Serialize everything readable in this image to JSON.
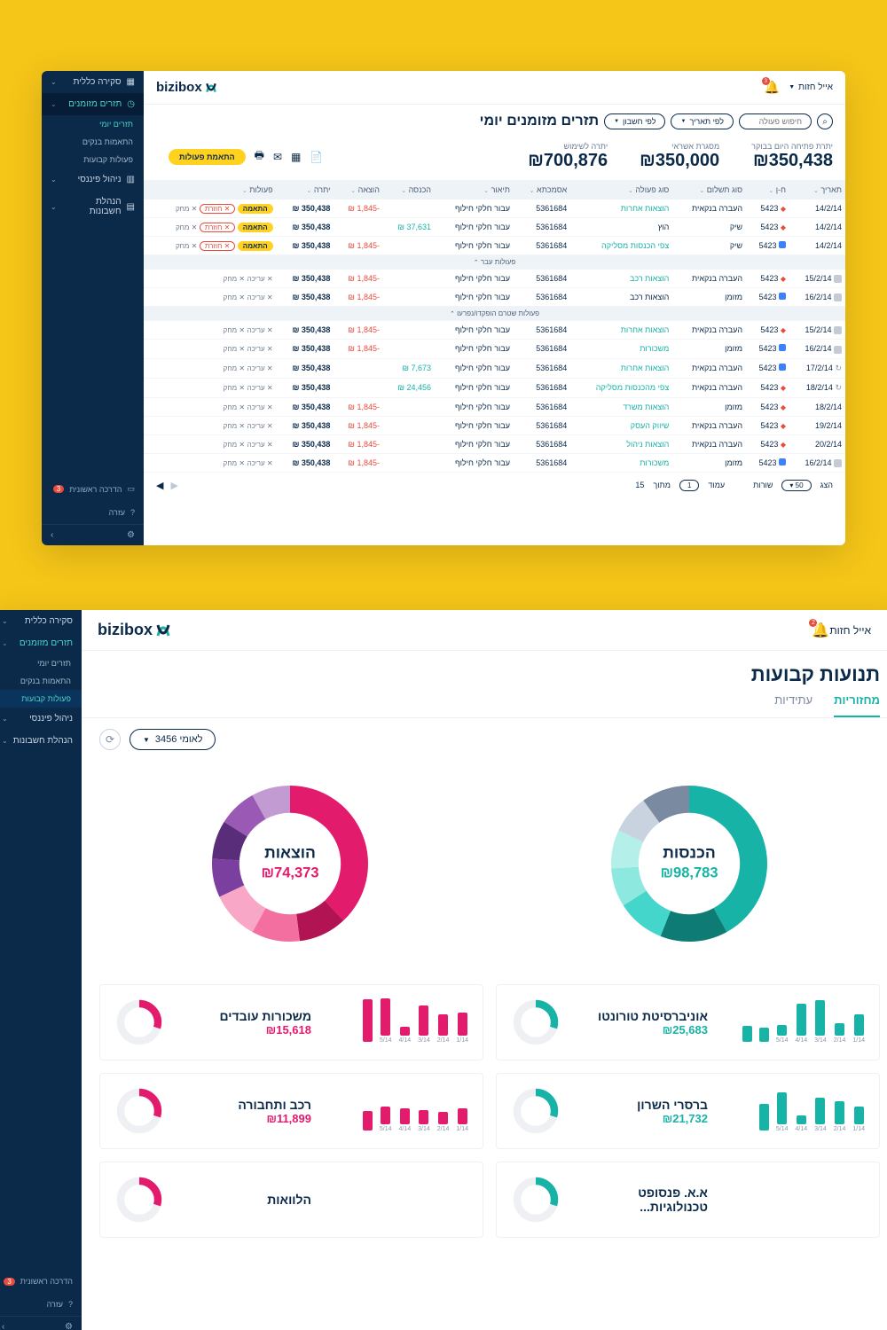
{
  "brand": "bizibox",
  "user_name": "אייל חזות",
  "notif_count": "3",
  "sidebar": {
    "items": [
      {
        "label": "סקירה כללית",
        "icon": "grid"
      },
      {
        "label": "תזרים מזומנים",
        "icon": "clock"
      },
      {
        "label": "ניהול פיננסי",
        "icon": "bars"
      },
      {
        "label": "הנהלת חשבונות",
        "icon": "ledger"
      }
    ],
    "sub_cashflow": [
      "תזרים יומי",
      "התאמות בנקים",
      "פעולות קבועות"
    ],
    "bottom_help_label": "הדרכה ראשונית",
    "bottom_help_badge": "3",
    "bottom_help2": "עזרה"
  },
  "screen1": {
    "title": "תזרים מזומנים יומי",
    "filters": {
      "by_account": "לפי חשבון",
      "by_date": "לפי תאריך",
      "search": "חיפוש פעולה"
    },
    "summary": [
      {
        "label": "יתרת פתיחה היום בבוקר",
        "value": "₪350,438"
      },
      {
        "label": "מסגרת אשראי",
        "value": "₪350,000"
      },
      {
        "label": "יתרה לשימוש",
        "value": "₪700,876"
      }
    ],
    "match_btn": "התאמת פעולות",
    "columns": [
      "תאריך",
      "ח-ן",
      "סוג תשלום",
      "סוג פעולה",
      "אסמכתא",
      "תיאור",
      "הכנסה",
      "הוצאה",
      "יתרה",
      "פעולות"
    ],
    "sep1": "פעולות עבר",
    "sep2": "פעולות שטרם הופקדו/נפרעו",
    "rows": [
      {
        "date": "14/2/14",
        "acc": "5423",
        "accmark": "red",
        "pay": "העברה בנקאית",
        "type": "הוצאות אחרות",
        "typec": "teal",
        "ref": "5361684",
        "desc": "עבור חלקי חילוף",
        "in": "",
        "out": "-1,845",
        "outc": "red",
        "bal": "350,438",
        "act1": "התאמה",
        "act2": "חוזרת",
        "act3": "מחק"
      },
      {
        "date": "14/2/14",
        "acc": "5423",
        "accmark": "red",
        "pay": "שיק",
        "type": "הוץ",
        "typec": "",
        "ref": "5361684",
        "desc": "עבור חלקי חילוף",
        "in": "37,631",
        "inc": "teal",
        "out": "",
        "bal": "350,438",
        "act1": "התאמה",
        "act2": "חוזרת",
        "act3": "מחק"
      },
      {
        "date": "14/2/14",
        "acc": "5423",
        "accmark": "blue",
        "pay": "שיק",
        "type": "צפי הכנסות מסליקה",
        "typec": "teal",
        "ref": "5361684",
        "desc": "עבור חלקי חילוף",
        "in": "",
        "out": "-1,845",
        "outc": "red",
        "bal": "350,438",
        "act1": "התאמה",
        "act2": "חוזרת",
        "act3": "מחק"
      }
    ],
    "rows2": [
      {
        "date": "15/2/14",
        "acc": "5423",
        "accmark": "red",
        "pay": "העברה בנקאית",
        "type": "הוצאות רכב",
        "typec": "teal",
        "ref": "5361684",
        "desc": "עבור חלקי חילוף",
        "in": "",
        "out": "-1,845",
        "outc": "red",
        "bal": "350,438",
        "act1": "",
        "act2": "עריכה",
        "act3": "מחק",
        "icon": "sq"
      },
      {
        "date": "16/2/14",
        "acc": "5423",
        "accmark": "blue",
        "pay": "מזומן",
        "type": "הוצאות רכב",
        "typec": "",
        "ref": "5361684",
        "desc": "עבור חלקי חילוף",
        "in": "",
        "out": "-1,845",
        "outc": "red",
        "bal": "350,438",
        "act1": "",
        "act2": "עריכה",
        "act3": "מחק",
        "icon": "sq"
      }
    ],
    "rows3": [
      {
        "date": "15/2/14",
        "acc": "5423",
        "accmark": "red",
        "pay": "העברה בנקאית",
        "type": "הוצאות אחרות",
        "typec": "teal",
        "ref": "5361684",
        "desc": "עבור חלקי חילוף",
        "in": "",
        "out": "-1,845",
        "outc": "red",
        "bal": "350,438",
        "act1": "",
        "act2": "עריכה",
        "act3": "מחק",
        "icon": "sq"
      },
      {
        "date": "16/2/14",
        "acc": "5423",
        "accmark": "blue",
        "pay": "מזומן",
        "type": "משכורות",
        "typec": "teal",
        "ref": "5361684",
        "desc": "עבור חלקי חילוף",
        "in": "",
        "out": "-1,845",
        "outc": "red",
        "bal": "350,438",
        "act1": "",
        "act2": "עריכה",
        "act3": "מחק",
        "icon": "sq"
      },
      {
        "date": "17/2/14",
        "acc": "5423",
        "accmark": "blue",
        "pay": "העברה בנקאית",
        "type": "הוצאות אחרות",
        "typec": "teal",
        "ref": "5361684",
        "desc": "עבור חלקי חילוף",
        "in": "7,673",
        "inc": "teal",
        "out": "",
        "bal": "350,438",
        "act1": "",
        "act2": "עריכה",
        "act3": "מחק",
        "icon": "cyc"
      },
      {
        "date": "18/2/14",
        "acc": "5423",
        "accmark": "red",
        "pay": "העברה בנקאית",
        "type": "צפי מהכנסות מסליקה",
        "typec": "teal",
        "ref": "5361684",
        "desc": "עבור חלקי חילוף",
        "in": "24,456",
        "inc": "teal",
        "out": "",
        "bal": "350,438",
        "act1": "",
        "act2": "עריכה",
        "act3": "מחק",
        "icon": "cyc"
      },
      {
        "date": "18/2/14",
        "acc": "5423",
        "accmark": "red",
        "pay": "מזומן",
        "type": "הוצאות משרד",
        "typec": "teal",
        "ref": "5361684",
        "desc": "עבור חלקי חילוף",
        "in": "",
        "out": "-1,845",
        "outc": "red",
        "bal": "350,438",
        "act1": "",
        "act2": "עריכה",
        "act3": "מחק"
      },
      {
        "date": "19/2/14",
        "acc": "5423",
        "accmark": "red",
        "pay": "העברה בנקאית",
        "type": "שיווק העסק",
        "typec": "teal",
        "ref": "5361684",
        "desc": "עבור חלקי חילוף",
        "in": "",
        "out": "-1,845",
        "outc": "red",
        "bal": "350,438",
        "act1": "",
        "act2": "עריכה",
        "act3": "מחק"
      },
      {
        "date": "20/2/14",
        "acc": "5423",
        "accmark": "red",
        "pay": "העברה בנקאית",
        "type": "הוצאות ניהול",
        "typec": "teal",
        "ref": "5361684",
        "desc": "עבור חלקי חילוף",
        "in": "",
        "out": "-1,845",
        "outc": "red",
        "bal": "350,438",
        "act1": "",
        "act2": "עריכה",
        "act3": "מחק"
      },
      {
        "date": "16/2/14",
        "acc": "5423",
        "accmark": "blue",
        "pay": "מזומן",
        "type": "משכורות",
        "typec": "teal",
        "ref": "5361684",
        "desc": "עבור חלקי חילוף",
        "in": "",
        "out": "-1,845",
        "outc": "red",
        "bal": "350,438",
        "act1": "",
        "act2": "עריכה",
        "act3": "מחק",
        "icon": "sq"
      }
    ],
    "pager": {
      "show": "הצג",
      "rows": "50",
      "rows_lbl": "שורות",
      "page_lbl": "עמוד",
      "page": "1",
      "of_lbl": "מתוך",
      "total": "15"
    }
  },
  "screen2": {
    "title": "תנועות קבועות",
    "tabs": [
      "מחזוריות",
      "עתידיות"
    ],
    "account_pill": "לאומי 3456",
    "donuts": {
      "income_label": "הכנסות",
      "income_val": "₪98,783",
      "expense_label": "הוצאות",
      "expense_val": "₪74,373"
    },
    "cards": [
      {
        "title": "אוניברסיטת טורונטו",
        "value": "₪25,683",
        "color": "teal",
        "bars": [
          24,
          14,
          40,
          36,
          12,
          16,
          18
        ],
        "labels": [
          "1/14",
          "2/14",
          "3/14",
          "4/14",
          "5/14",
          "",
          ""
        ]
      },
      {
        "title": "משכורות עובדים",
        "value": "₪15,618",
        "color": "pink",
        "bars": [
          26,
          24,
          34,
          10,
          42,
          48
        ],
        "labels": [
          "1/14",
          "2/14",
          "3/14",
          "4/14",
          "5/14",
          ""
        ]
      },
      {
        "title": "ברסרי השרון",
        "value": "₪21,732",
        "color": "teal",
        "bars": [
          20,
          26,
          30,
          10,
          36,
          30
        ],
        "labels": [
          "1/14",
          "2/14",
          "3/14",
          "4/14",
          "5/14",
          ""
        ]
      },
      {
        "title": "רכב ותחבורה",
        "value": "₪11,899",
        "color": "pink",
        "bars": [
          18,
          14,
          16,
          18,
          20,
          22
        ],
        "labels": [
          "1/14",
          "2/14",
          "3/14",
          "4/14",
          "5/14",
          ""
        ]
      },
      {
        "title": "א.א. פנסופט טכנולוגיות...",
        "value": "",
        "color": "teal",
        "bars": [],
        "labels": []
      },
      {
        "title": "הלוואות",
        "value": "",
        "color": "pink",
        "bars": [],
        "labels": []
      }
    ]
  },
  "chart_data": [
    {
      "type": "pie",
      "title": "הכנסות",
      "total": 98783,
      "unit": "₪",
      "slices": [
        {
          "name": "s1",
          "value": 42
        },
        {
          "name": "s2",
          "value": 14
        },
        {
          "name": "s3",
          "value": 10
        },
        {
          "name": "s4",
          "value": 8
        },
        {
          "name": "s5",
          "value": 8
        },
        {
          "name": "s6",
          "value": 8
        },
        {
          "name": "s7",
          "value": 10
        }
      ],
      "palette": [
        "#18b3a7",
        "#0e7c74",
        "#45d6cb",
        "#8de8e0",
        "#b5efe9",
        "#c9d3df",
        "#7a8aa0"
      ]
    },
    {
      "type": "pie",
      "title": "הוצאות",
      "total": 74373,
      "unit": "₪",
      "slices": [
        {
          "name": "s1",
          "value": 38
        },
        {
          "name": "s2",
          "value": 10
        },
        {
          "name": "s3",
          "value": 10
        },
        {
          "name": "s4",
          "value": 10
        },
        {
          "name": "s5",
          "value": 8
        },
        {
          "name": "s6",
          "value": 8
        },
        {
          "name": "s7",
          "value": 8
        },
        {
          "name": "s8",
          "value": 8
        }
      ],
      "palette": [
        "#e31b6d",
        "#b21453",
        "#f36fa0",
        "#f8a8c6",
        "#7b3fa0",
        "#5a2d7a",
        "#9b59b6",
        "#c39bd3"
      ]
    },
    {
      "type": "bar",
      "title": "אוניברסיטת טורונטו",
      "categories": [
        "1/14",
        "2/14",
        "3/14",
        "4/14",
        "5/14"
      ],
      "values": [
        24,
        14,
        40,
        36,
        12
      ],
      "color": "#18b3a7",
      "ylabel": "",
      "ylim": [
        0,
        50
      ]
    },
    {
      "type": "bar",
      "title": "משכורות עובדים",
      "categories": [
        "1/14",
        "2/14",
        "3/14",
        "4/14",
        "5/14"
      ],
      "values": [
        26,
        24,
        34,
        10,
        42
      ],
      "color": "#e31b6d",
      "ylabel": "",
      "ylim": [
        0,
        50
      ]
    },
    {
      "type": "bar",
      "title": "ברסרי השרון",
      "categories": [
        "1/14",
        "2/14",
        "3/14",
        "4/14",
        "5/14"
      ],
      "values": [
        20,
        26,
        30,
        10,
        36
      ],
      "color": "#18b3a7",
      "ylabel": "",
      "ylim": [
        0,
        50
      ]
    },
    {
      "type": "bar",
      "title": "רכב ותחבורה",
      "categories": [
        "1/14",
        "2/14",
        "3/14",
        "4/14",
        "5/14"
      ],
      "values": [
        18,
        14,
        16,
        18,
        20
      ],
      "color": "#e31b6d",
      "ylabel": "",
      "ylim": [
        0,
        50
      ]
    }
  ]
}
